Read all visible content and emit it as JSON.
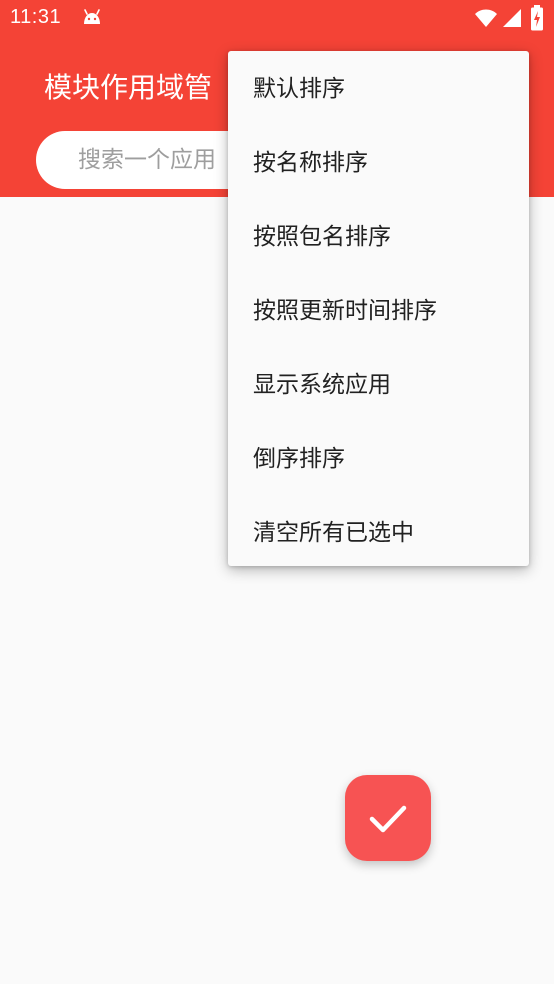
{
  "status_bar": {
    "time": "11:31",
    "icons": [
      "android-icon",
      "wifi-icon",
      "signal-icon",
      "battery-charging-icon"
    ]
  },
  "app_bar": {
    "title": "模块作用域管",
    "color": "#f44336"
  },
  "search": {
    "placeholder": "搜索一个应用"
  },
  "menu": {
    "items": [
      {
        "label": "默认排序"
      },
      {
        "label": "按名称排序"
      },
      {
        "label": "按照包名排序"
      },
      {
        "label": "按照更新时间排序"
      },
      {
        "label": "显示系统应用"
      },
      {
        "label": "倒序排序"
      },
      {
        "label": "清空所有已选中"
      }
    ]
  },
  "fab": {
    "icon": "check-icon",
    "color": "#f75353"
  }
}
